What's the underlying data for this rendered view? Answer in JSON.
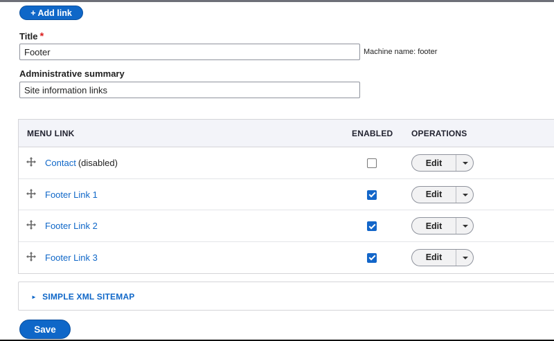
{
  "toolbar": {
    "add_link_label": "+ Add link"
  },
  "form": {
    "title_label": "Title",
    "required_mark": "*",
    "title_value": "Footer",
    "machine_name": "Machine name: footer",
    "summary_label": "Administrative summary",
    "summary_value": "Site information links"
  },
  "table": {
    "headers": {
      "menu_link": "MENU LINK",
      "enabled": "ENABLED",
      "operations": "OPERATIONS"
    },
    "rows": [
      {
        "label": "Contact",
        "status": "(disabled)",
        "enabled": false,
        "operation": "Edit"
      },
      {
        "label": "Footer Link 1",
        "status": "",
        "enabled": true,
        "operation": "Edit"
      },
      {
        "label": "Footer Link 2",
        "status": "",
        "enabled": true,
        "operation": "Edit"
      },
      {
        "label": "Footer Link 3",
        "status": "",
        "enabled": true,
        "operation": "Edit"
      }
    ]
  },
  "details": {
    "sitemap_label": "SIMPLE XML SITEMAP",
    "expand_glyph": "►"
  },
  "actions": {
    "save_label": "Save"
  },
  "icons": {
    "drag": "move-arrows-icon",
    "toggle": "caret-down-icon"
  },
  "colors": {
    "accent": "#0f67c8",
    "required": "#dc2323"
  }
}
